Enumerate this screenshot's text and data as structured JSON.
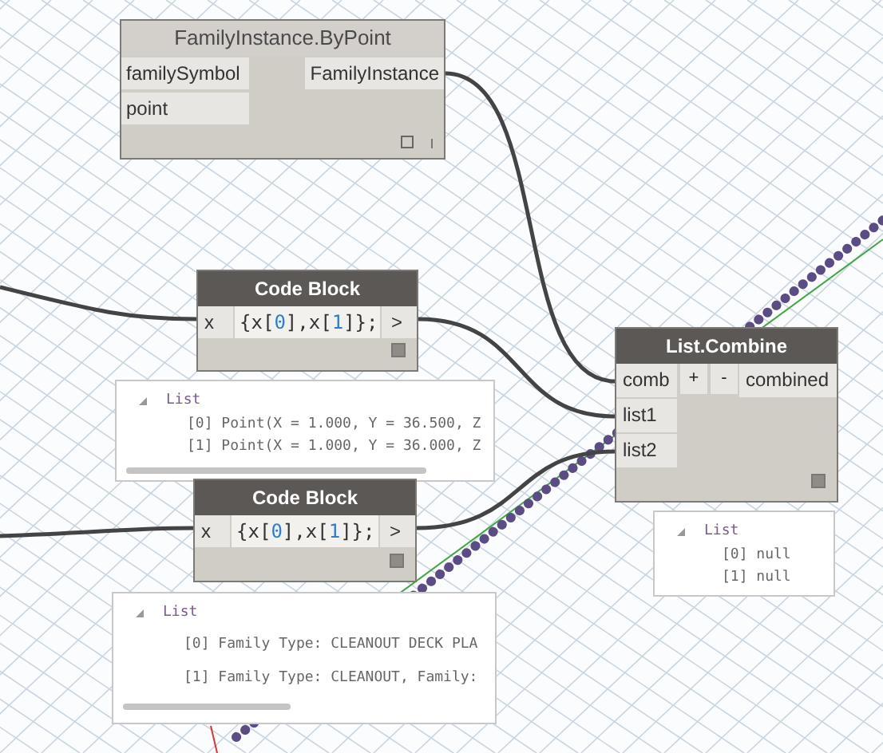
{
  "nodes": [
    {
      "kind": "function",
      "title": "FamilyInstance.ByPoint",
      "inputs": [
        "familySymbol",
        "point"
      ],
      "outputs": [
        "FamilyInstance"
      ]
    },
    {
      "kind": "code",
      "title": "Code Block",
      "inputs": [
        "x"
      ],
      "code": "{x[0],x[1]};",
      "outputs": [
        ">"
      ],
      "preview": {
        "label": "List",
        "expanded": true,
        "items": [
          "[0] Point(X = 1.000, Y = 36.500, Z",
          "[1] Point(X = 1.000, Y = 36.000, Z"
        ]
      }
    },
    {
      "kind": "code",
      "title": "Code Block",
      "inputs": [
        "x"
      ],
      "code": "{x[0],x[1]};",
      "outputs": [
        ">"
      ],
      "preview": {
        "label": "List",
        "expanded": true,
        "items": [
          "[0] Family Type: CLEANOUT DECK PLA",
          "[1] Family Type: CLEANOUT, Family:"
        ]
      }
    },
    {
      "kind": "combine",
      "title": "List.Combine",
      "inputs": [
        "comb",
        "list1",
        "list2"
      ],
      "buttons": [
        "+",
        "-"
      ],
      "outputs": [
        "combined"
      ],
      "preview": {
        "label": "List",
        "expanded": true,
        "items": [
          "[0] null",
          "[1] null"
        ]
      }
    }
  ]
}
